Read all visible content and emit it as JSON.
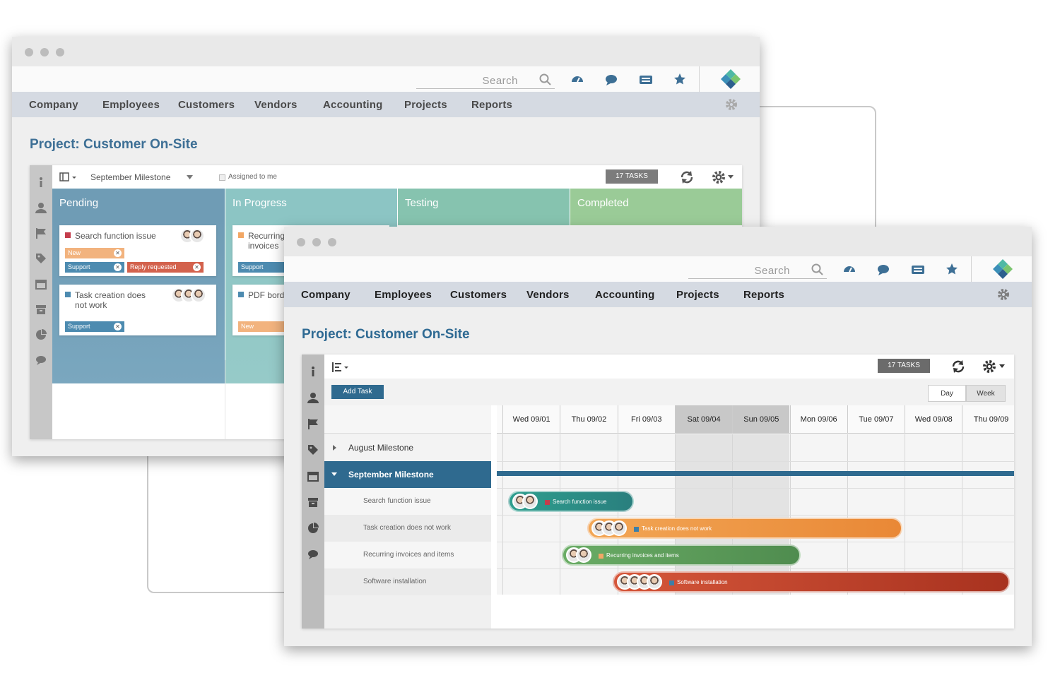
{
  "nav": {
    "search_placeholder": "Search",
    "items": [
      "Company",
      "Employees",
      "Customers",
      "Vendors",
      "Accounting",
      "Projects",
      "Reports"
    ]
  },
  "project_title": "Project: Customer On-Site",
  "board": {
    "milestone_select": "September Milestone",
    "assigned_to_me": "Assigned to me",
    "tasks_badge": "17 TASKS",
    "columns": [
      {
        "title": "Pending",
        "color": "#6f9cb5"
      },
      {
        "title": "In Progress",
        "color": "#8cc5c4"
      },
      {
        "title": "Testing",
        "color": "#86c3af"
      },
      {
        "title": "Completed",
        "color": "#9acb97"
      }
    ],
    "cards": [
      {
        "title": "Search function issue",
        "tags": [
          "New",
          "Support",
          "Reply requested"
        ]
      },
      {
        "title": "Task creation does not work",
        "tags": [
          "Support"
        ]
      },
      {
        "title": "Recurring invoices and items",
        "tags": [
          "Support"
        ]
      },
      {
        "title": "PDF bord",
        "tags": [
          "New"
        ]
      }
    ]
  },
  "gantt": {
    "add_task": "Add Task",
    "tasks_badge": "17 TASKS",
    "view_day": "Day",
    "view_week": "Week",
    "days": [
      "Wed 09/01",
      "Thu 09/02",
      "Fri 09/03",
      "Sat 09/04",
      "Sun 09/05",
      "Mon 09/06",
      "Tue 09/07",
      "Wed 09/08",
      "Thu 09/09"
    ],
    "milestones": [
      "August Milestone",
      "September Milestone"
    ],
    "tasks": [
      {
        "label": "Search function issue",
        "color": "#2e9e8e"
      },
      {
        "label": "Task creation does not work",
        "color": "#ec9444"
      },
      {
        "label": "Recurring invoices and items",
        "color": "#5d9e5b"
      },
      {
        "label": "Software installation",
        "color": "#c2472d"
      }
    ]
  },
  "colors": {
    "accent": "#3d6f95",
    "menu_bg": "#d5dae2"
  }
}
